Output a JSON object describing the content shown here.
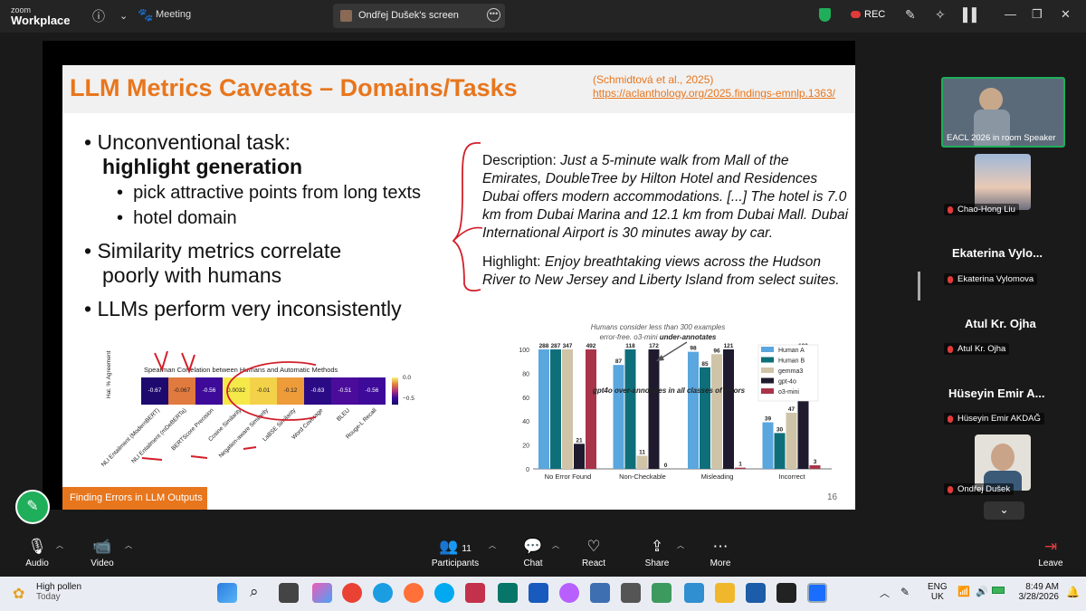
{
  "window": {
    "logo_top": "zoom",
    "logo_bottom": "Workplace",
    "meeting_label": "Meeting",
    "share_tab": "Ondřej Dušek's screen",
    "rec_label": "REC"
  },
  "slide": {
    "title": "LLM Metrics Caveats – Domains/Tasks",
    "cite_line1": "(Schmidtová et al., 2025)",
    "cite_line2": "https://aclanthology.org/2025.findings-emnlp.1363/",
    "bullet1a": "Unconventional task:",
    "bullet1b": "highlight generation",
    "sub1": "pick attractive points from long texts",
    "sub2": "hotel domain",
    "bullet2a": "Similarity metrics correlate",
    "bullet2b": "poorly with humans",
    "bullet3": "LLMs perform very inconsistently",
    "desc_label": "Description: ",
    "desc_text": "Just a 5-minute walk from Mall of the Emirates, DoubleTree by Hilton Hotel and Residences Dubai offers modern accommodations. [...] The hotel is 7.0 km from Dubai Marina and  12.1 km from Dubai Mall. Dubai International Airport is 30 minutes away by car.",
    "hl_label": "Highlight: ",
    "hl_text": "Enjoy breathtaking views across the Hudson River to New Jersey and Liberty Island from select suites.",
    "footer": "Finding Errors in LLM Outputs",
    "page": "16"
  },
  "chart_data": [
    {
      "type": "heatmap",
      "title": "Spearman Correlation between Humans and Automatic Methods",
      "ylabel": "Hal. % Agreement",
      "categories": [
        "NLI Entailment (ModernBERT)",
        "NLI Entailment (mDeBERTa)",
        "BERTScore Precision",
        "Cosine Similarity",
        "Negation-aware Similarity",
        "LaBSE Similarity",
        "Word Coverage",
        "BLEU",
        "Rouge-L Recall"
      ],
      "values": [
        -0.67,
        -0.067,
        -0.56,
        0.0032,
        -0.01,
        -0.12,
        -0.63,
        -0.51,
        -0.56
      ],
      "value_labels": [
        "-0.67",
        "-0.067",
        "-0.56",
        "0.0032",
        "-0.01",
        "-0.12",
        "-0.63",
        "-0.51",
        "-0.56"
      ],
      "colorbar_ticks": [
        "0.0",
        "−0.5"
      ],
      "cell_colors": [
        "#1e0a6e",
        "#e07a3e",
        "#3d0a9a",
        "#f5e94a",
        "#f3d24a",
        "#ee9b3a",
        "#2a0a85",
        "#4b0c9b",
        "#3d0a9a"
      ]
    },
    {
      "type": "bar",
      "annotation_top": "Humans consider less than 300 examples error-free. o3-mini ",
      "annotation_top_bold": "under-annotates",
      "annotation_mid": "gpt4o over-annotates in all classes of errors",
      "categories": [
        "No Error Found",
        "Non-Checkable",
        "Misleading",
        "Incorrect"
      ],
      "ylim": [
        0,
        100
      ],
      "yticks": [
        "0",
        "20",
        "40",
        "60",
        "80",
        "100"
      ],
      "series": [
        {
          "name": "Human A",
          "color": "#5aa6de",
          "values": [
            288,
            87,
            98,
            39
          ]
        },
        {
          "name": "Human B",
          "color": "#0e6f7a",
          "values": [
            287,
            118,
            85,
            30
          ]
        },
        {
          "name": "gemma3",
          "color": "#cfc4a8",
          "values": [
            347,
            11,
            96,
            47
          ]
        },
        {
          "name": "gpt-4o",
          "color": "#1f1a2e",
          "values": [
            21,
            172,
            121,
            199
          ]
        },
        {
          "name": "o3-mini",
          "color": "#a8344a",
          "values": [
            492,
            0,
            1,
            3
          ]
        }
      ]
    }
  ],
  "panel": {
    "main_label": "EACL 2026 in room Speaker",
    "p1_tag": "Chao-Hong Liu",
    "p2_name": "Ekaterina  Vylo...",
    "p2_tag": "Ekaterina Vylomova",
    "p3_name": "Atul Kr. Ojha",
    "p3_tag": "Atul Kr. Ojha",
    "p4_name": "Hüseyin Emir  A...",
    "p4_tag": "Hüseyin Emir AKDAĞ",
    "p5_tag": "Ondřej Dušek"
  },
  "toolbar": {
    "audio": "Audio",
    "video": "Video",
    "participants": "Participants",
    "participants_count": "11",
    "chat": "Chat",
    "react": "React",
    "share": "Share",
    "more": "More",
    "leave": "Leave"
  },
  "taskbar": {
    "weather_title": "High pollen",
    "weather_sub": "Today",
    "lang1": "ENG",
    "lang2": "UK",
    "time": "8:49 AM",
    "date": "3/28/2026"
  },
  "colors": {
    "accent": "#e8761d",
    "green": "#1fae5a",
    "record": "#e23a3a"
  }
}
